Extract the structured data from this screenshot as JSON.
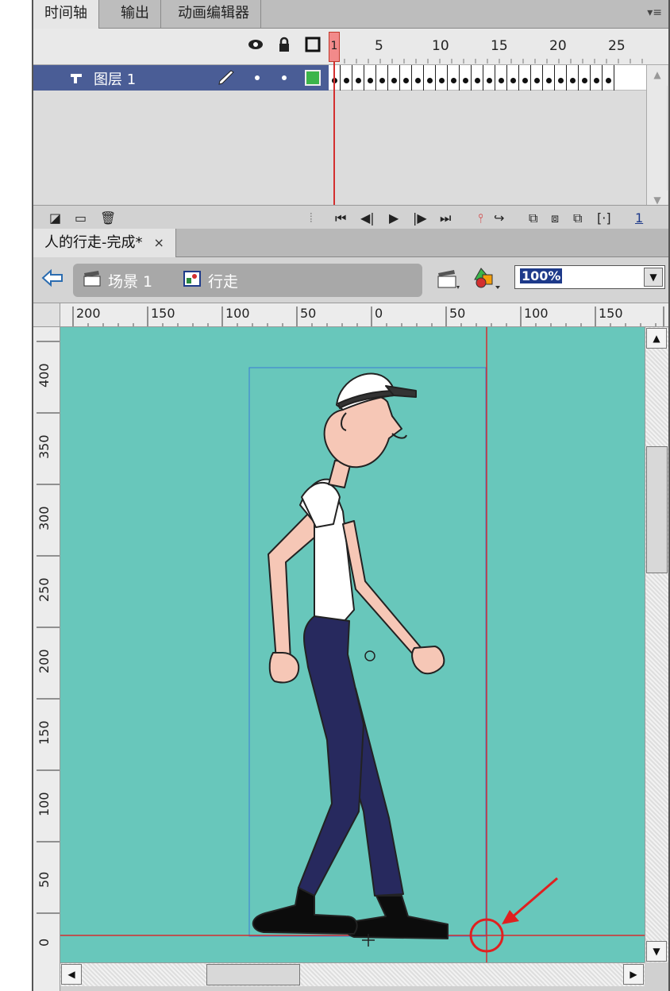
{
  "timeline_tabs": [
    "时间轴",
    "输出",
    "动画编辑器"
  ],
  "panel_menu_glyph": "▾≡",
  "frame_numbers": [
    "5",
    "10",
    "15",
    "20",
    "25"
  ],
  "current_frame": "1",
  "layer": {
    "name": "图层 1"
  },
  "frame_count": 24,
  "footer_page": "1",
  "document": {
    "tab_title": "人的行走-完成*",
    "close_glyph": "×"
  },
  "breadcrumb": {
    "scene": "场景 1",
    "symbol": "行走"
  },
  "zoom": "100%",
  "ruler_h": [
    "200",
    "150",
    "100",
    "50",
    "0",
    "50",
    "100",
    "150"
  ],
  "ruler_v": [
    "400",
    "350",
    "300",
    "250",
    "200",
    "150",
    "100",
    "50",
    "0"
  ],
  "colors": {
    "stage": "#68c7bb",
    "layer_selected": "#4a5d96",
    "playhead": "#d32f2f",
    "annotation": "#e02020",
    "pants": "#27295e",
    "skin": "#f6c7b6"
  }
}
